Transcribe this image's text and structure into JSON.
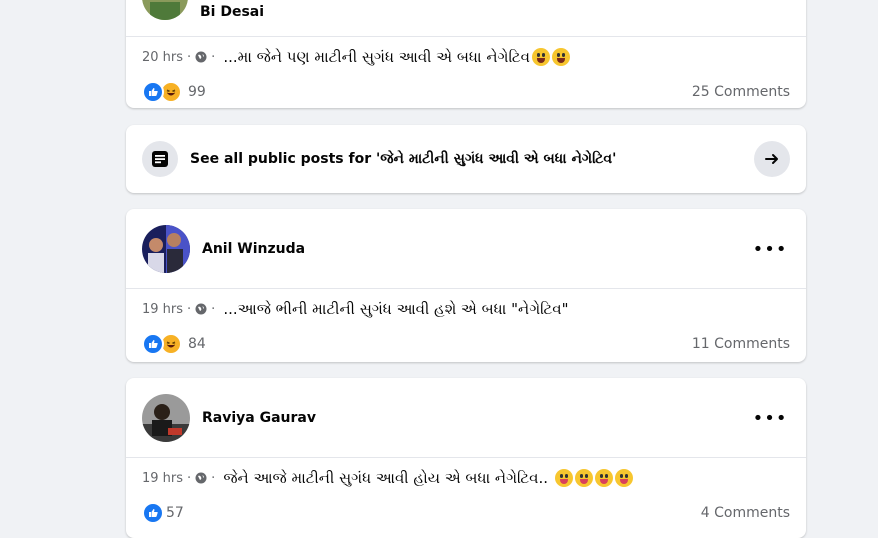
{
  "posts": [
    {
      "author": "Bi Desai",
      "time": "20 hrs",
      "snippet": "...મા જેને પણ માટીની સુગંધ આવી એ બધા નેગેટિવ",
      "reaction_count": "99",
      "comments": "25 Comments"
    },
    {
      "author": "Anil Winzuda",
      "time": "19 hrs",
      "snippet": "...આજે ભીની માટીની સુગંધ આવી હશે એ બધા \"નેગેટિવ\"",
      "reaction_count": "84",
      "comments": "11 Comments"
    },
    {
      "author": "Raviya Gaurav",
      "time": "19 hrs",
      "snippet": "જેને આજે માટીની સુગંધ આવી હોય એ બધા નેગેટિવ..",
      "reaction_count": "57",
      "comments": "4 Comments"
    }
  ],
  "see_all": {
    "label": "See all public posts for 'જેને માટીની સુગંધ આવી એ બધા નેગેટિવ'"
  },
  "icons": {
    "more": "more-options-icon",
    "globe": "globe-icon",
    "arrow": "arrow-right-icon",
    "posts": "posts-list-icon"
  },
  "colors": {
    "like": "#1877f2",
    "haha": "#f7b125",
    "background": "#f0f2f5"
  }
}
